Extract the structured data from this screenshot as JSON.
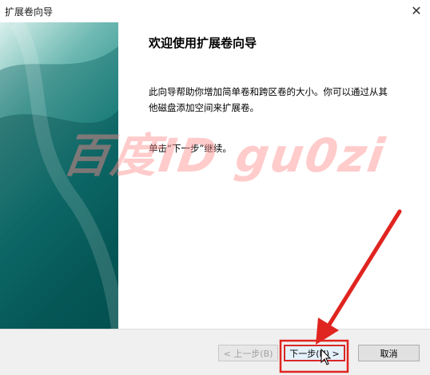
{
  "window": {
    "title": "扩展卷向导",
    "close_icon": "close-icon"
  },
  "page": {
    "heading": "欢迎使用扩展卷向导",
    "description": "此向导帮助你增加简单卷和跨区卷的大小。你可以通过从其他磁盘添加空间来扩展卷。",
    "instruction": "单击“下一步”继续。"
  },
  "buttons": {
    "back": "< 上一步(B)",
    "next": "下一步(N) >",
    "cancel": "取消"
  },
  "watermark": {
    "text": "百度ID gu0zi"
  },
  "colors": {
    "annotation": "#e0241f",
    "banner_dark": "#0a5556"
  }
}
